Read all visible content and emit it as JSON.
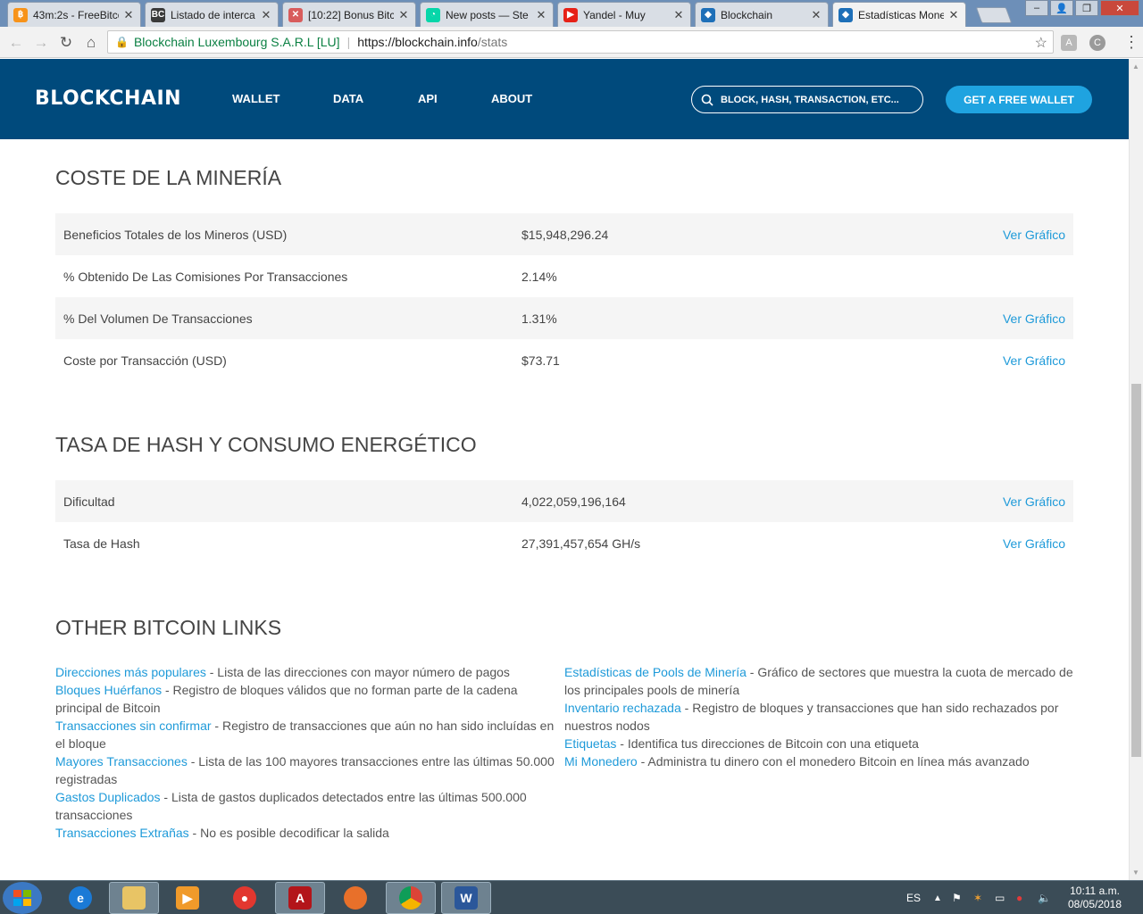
{
  "browser": {
    "tabs": [
      {
        "title": "43m:2s - FreeBitco",
        "fav": "bitcoin-icon",
        "color": "#f7931a",
        "glyph": "฿",
        "active": false
      },
      {
        "title": "Listado de interca",
        "fav": "bc-icon",
        "color": "#3a3a3a",
        "glyph": "BC",
        "active": false
      },
      {
        "title": "[10:22] Bonus Bitc",
        "fav": "bonus-icon",
        "color": "#d85c5c",
        "glyph": "✕",
        "active": false
      },
      {
        "title": "New posts — Ste",
        "fav": "steemit-icon",
        "color": "#06d6a9",
        "glyph": "◔",
        "active": false
      },
      {
        "title": "Yandel - Muy",
        "fav": "youtube-icon",
        "color": "#e62117",
        "glyph": "▶",
        "active": false
      },
      {
        "title": "Blockchain",
        "fav": "blockchain-icon",
        "color": "#1d6fb8",
        "glyph": "◆",
        "active": false
      },
      {
        "title": "Estadísticas Mone",
        "fav": "blockchain-icon",
        "color": "#1d6fb8",
        "glyph": "◆",
        "active": true
      }
    ],
    "secure_label": "Blockchain Luxembourg S.A.R.L [LU]",
    "url_host": "https://blockchain.info",
    "url_path": "/stats"
  },
  "header": {
    "logo": "BLOCKCHAIN",
    "nav": [
      "WALLET",
      "DATA",
      "API",
      "ABOUT"
    ],
    "search_placeholder": "BLOCK, HASH, TRANSACTION, ETC...",
    "cta": "GET A FREE WALLET"
  },
  "mining_cost": {
    "title": "COSTE DE LA MINERÍA",
    "rows": [
      {
        "label": "Beneficios Totales de los Mineros (USD)",
        "value": "$15,948,296.24",
        "link": "Ver Gráfico"
      },
      {
        "label": "% Obtenido De Las Comisiones Por Transacciones",
        "value": "2.14%",
        "link": ""
      },
      {
        "label": "% Del Volumen De Transacciones",
        "value": "1.31%",
        "link": "Ver Gráfico"
      },
      {
        "label": "Coste por Transacción (USD)",
        "value": "$73.71",
        "link": "Ver Gráfico"
      }
    ]
  },
  "hash_rate": {
    "title": "TASA DE HASH Y CONSUMO ENERGÉTICO",
    "rows": [
      {
        "label": "Dificultad",
        "value": "4,022,059,196,164",
        "link": "Ver Gráfico"
      },
      {
        "label": "Tasa de Hash",
        "value": "27,391,457,654 GH/s",
        "link": "Ver Gráfico"
      }
    ]
  },
  "other_links": {
    "title": "OTHER BITCOIN LINKS",
    "left": [
      {
        "link": "Direcciones más populares",
        "desc": " - Lista de las direcciones con mayor número de pagos"
      },
      {
        "link": "Bloques Huérfanos",
        "desc": " - Registro de bloques válidos que no forman parte de la cadena principal de Bitcoin"
      },
      {
        "link": "Transacciones sin confirmar",
        "desc": " - Registro de transacciones que aún no han sido incluídas en el bloque"
      },
      {
        "link": "Mayores Transacciones",
        "desc": " - Lista de las 100 mayores transacciones entre las últimas 50.000 registradas"
      },
      {
        "link": "Gastos Duplicados",
        "desc": " - Lista de gastos duplicados detectados entre las últimas 500.000 transacciones"
      },
      {
        "link": "Transacciones Extrañas",
        "desc": " - No es posible decodificar la salida"
      }
    ],
    "right": [
      {
        "link": "Estadísticas de Pools de Minería",
        "desc": " - Gráfico de sectores que muestra la cuota de mercado de los principales pools de minería"
      },
      {
        "link": "Inventario rechazada",
        "desc": " - Registro de bloques y transacciones que han sido rechazados por nuestros nodos"
      },
      {
        "link": "Etiquetas",
        "desc": " - Identifica tus direcciones de Bitcoin con una etiqueta"
      },
      {
        "link": "Mi Monedero",
        "desc": " - Administra tu dinero con el monedero Bitcoin en línea más avanzado"
      }
    ]
  },
  "taskbar": {
    "lang": "ES",
    "time": "10:11 a.m.",
    "date": "08/05/2018"
  },
  "colors": {
    "header_bg": "#004a7c",
    "accent": "#1fa3e0",
    "link": "#1e9ad9"
  }
}
